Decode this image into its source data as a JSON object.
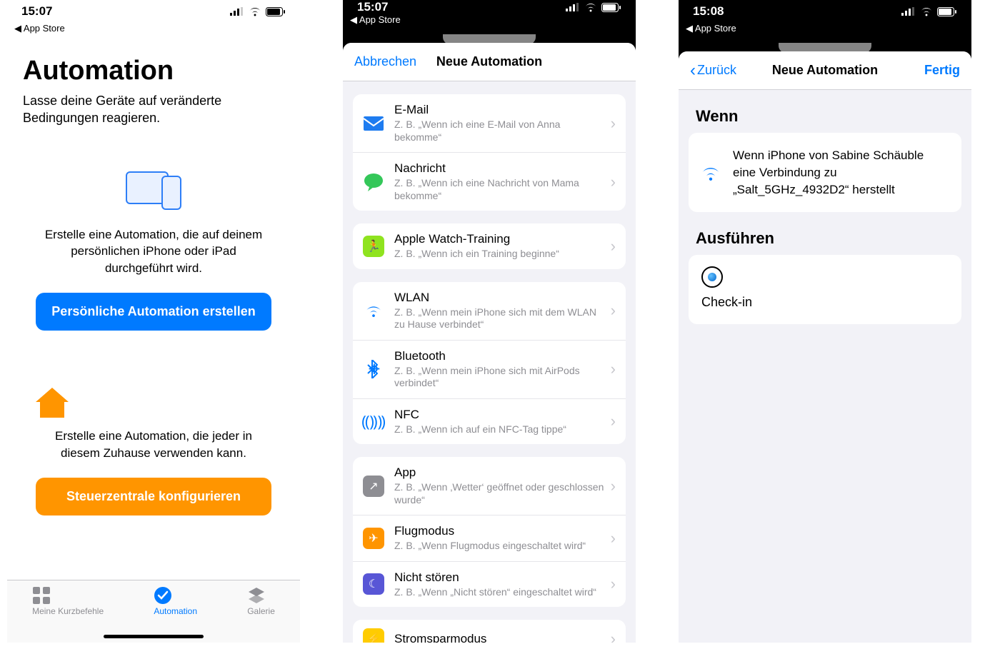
{
  "colors": {
    "accent_blue": "#007aff",
    "accent_orange": "#ff9500"
  },
  "panel1": {
    "status_time": "15:07",
    "back_app": "◀︎ App Store",
    "title": "Automation",
    "subtitle": "Lasse deine Geräte auf veränderte Bedingungen reagieren.",
    "card_personal": {
      "desc": "Erstelle eine Automation, die auf deinem persönlichen iPhone oder iPad durchgeführt wird.",
      "button": "Persönliche Automation erstellen"
    },
    "card_home": {
      "desc": "Erstelle eine Automation, die jeder in diesem Zuhause verwenden kann.",
      "button": "Steuerzentrale konfigurieren"
    },
    "tabs": [
      {
        "label": "Meine Kurzbefehle",
        "icon": "grid"
      },
      {
        "label": "Automation",
        "icon": "clock"
      },
      {
        "label": "Galerie",
        "icon": "stack"
      }
    ]
  },
  "panel2": {
    "status_time": "15:07",
    "back_app": "◀︎ App Store",
    "cancel": "Abbrechen",
    "title": "Neue Automation",
    "groups": [
      [
        {
          "icon": "mail",
          "title": "E-Mail",
          "sub": "Z. B. „Wenn ich eine E-Mail von Anna bekomme“"
        },
        {
          "icon": "message",
          "title": "Nachricht",
          "sub": "Z. B. „Wenn ich eine Nachricht von Mama bekomme“"
        }
      ],
      [
        {
          "icon": "workout",
          "title": "Apple Watch-Training",
          "sub": "Z. B. „Wenn ich ein Training beginne“"
        }
      ],
      [
        {
          "icon": "wifi",
          "title": "WLAN",
          "sub": "Z. B. „Wenn mein iPhone sich mit dem WLAN zu Hause verbindet“"
        },
        {
          "icon": "bluetooth",
          "title": "Bluetooth",
          "sub": "Z. B. „Wenn mein iPhone sich mit AirPods verbindet“"
        },
        {
          "icon": "nfc",
          "title": "NFC",
          "sub": "Z. B. „Wenn ich auf ein NFC-Tag tippe“"
        }
      ],
      [
        {
          "icon": "app",
          "title": "App",
          "sub": "Z. B. „Wenn ‚Wetter‘ geöffnet oder geschlossen wurde“"
        },
        {
          "icon": "airplane",
          "title": "Flugmodus",
          "sub": "Z. B. „Wenn Flugmodus eingeschaltet wird“"
        },
        {
          "icon": "dnd",
          "title": "Nicht stören",
          "sub": "Z. B. „Wenn „Nicht stören“ eingeschaltet wird“"
        }
      ],
      [
        {
          "icon": "battery",
          "title": "Stromsparmodus",
          "sub": ""
        }
      ]
    ]
  },
  "panel3": {
    "status_time": "15:08",
    "back_app": "◀︎ App Store",
    "back": "Zurück",
    "title": "Neue Automation",
    "done": "Fertig",
    "when_label": "Wenn",
    "when_text": "Wenn iPhone von Sabine Schäuble eine Verbindung zu „Salt_5GHz_4932D2“ herstellt",
    "exec_label": "Ausführen",
    "action_name": "Check-in"
  }
}
